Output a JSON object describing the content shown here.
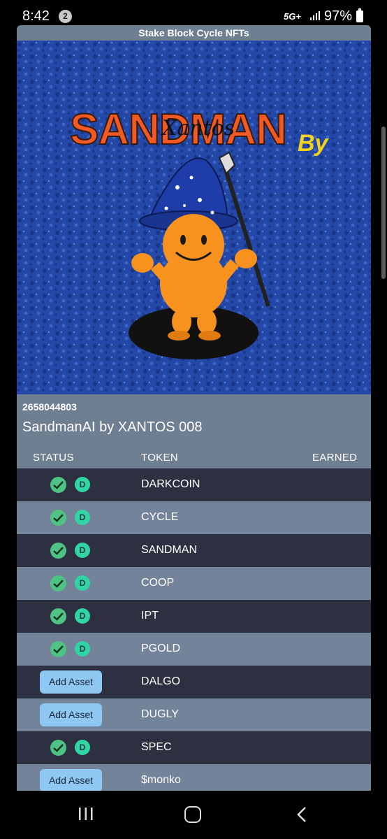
{
  "status_bar": {
    "time": "8:42",
    "notification_count": "2",
    "network": "5G+",
    "battery": "97%"
  },
  "app": {
    "title": "Stake Block Cycle NFTs",
    "artwork": {
      "headline": "SANDMAN",
      "signature": "Xantos",
      "by_text": "By"
    },
    "asset_id": "2658044803",
    "asset_name": "SandmanAI by XANTOS 008",
    "columns": {
      "status": "STATUS",
      "token": "TOKEN",
      "earned": "EARNED"
    },
    "rows": [
      {
        "token": "DARKCOIN",
        "status": "staked",
        "badge": "D",
        "shade": "dark"
      },
      {
        "token": "CYCLE",
        "status": "staked",
        "badge": "D",
        "shade": "light"
      },
      {
        "token": "SANDMAN",
        "status": "staked",
        "badge": "D",
        "shade": "dark"
      },
      {
        "token": "COOP",
        "status": "staked",
        "badge": "D",
        "shade": "light"
      },
      {
        "token": "IPT",
        "status": "staked",
        "badge": "D",
        "shade": "dark"
      },
      {
        "token": "PGOLD",
        "status": "staked",
        "badge": "D",
        "shade": "light"
      },
      {
        "token": "DALGO",
        "status": "add",
        "button_label": "Add Asset",
        "shade": "dark"
      },
      {
        "token": "DUGLY",
        "status": "add",
        "button_label": "Add Asset",
        "shade": "light"
      },
      {
        "token": "SPEC",
        "status": "staked",
        "badge": "D",
        "shade": "dark"
      },
      {
        "token": "$monko",
        "status": "add",
        "button_label": "Add Asset",
        "shade": "light"
      }
    ]
  },
  "colors": {
    "row_dark": "#2c3040",
    "row_light": "#73839a",
    "check": "#4fc383",
    "badge": "#31d5a3",
    "button": "#8ec7f2"
  }
}
